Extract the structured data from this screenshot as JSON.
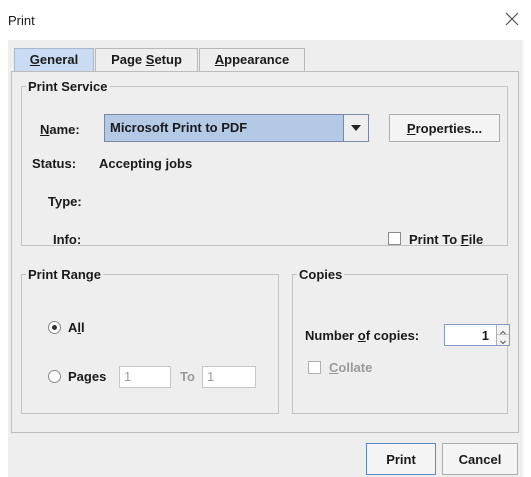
{
  "window": {
    "title": "Print"
  },
  "tabs": [
    {
      "label": "General",
      "mnemonic": "G",
      "rest": "eneral"
    },
    {
      "label": "Page Setup",
      "pre": "Page ",
      "mnemonic": "S",
      "rest": "etup"
    },
    {
      "label": "Appearance",
      "mnemonic": "A",
      "rest": "ppearance"
    }
  ],
  "print_service": {
    "legend": "Print Service",
    "name_label_mn": "N",
    "name_label_rest": "ame:",
    "printer": "Microsoft Print to PDF",
    "properties_mn": "P",
    "properties_rest": "roperties...",
    "status_label": "Status:",
    "status_value": "Accepting jobs",
    "type_label": "Type:",
    "info_label": "Info:",
    "print_to_file_pre": "Print To ",
    "print_to_file_mn": "F",
    "print_to_file_rest": "ile",
    "print_to_file_checked": false
  },
  "print_range": {
    "legend": "Print Range",
    "all_pre": "A",
    "all_mn": "l",
    "all_rest": "l",
    "all_selected": true,
    "pages_pre": "Pa",
    "pages_mn": "g",
    "pages_rest": "es",
    "from_value": "1",
    "to_label": "To",
    "to_value": "1"
  },
  "copies": {
    "legend": "Copies",
    "number_pre": "Number ",
    "number_mn": "o",
    "number_rest": "f copies:",
    "count": "1",
    "collate_mn": "C",
    "collate_rest": "ollate",
    "collate_checked": false
  },
  "buttons": {
    "print": "Print",
    "cancel": "Cancel"
  },
  "colors": {
    "tab_selected": "#c9dcf4",
    "combo_bg": "#b3c9e6",
    "default_border": "#5a88c8"
  }
}
